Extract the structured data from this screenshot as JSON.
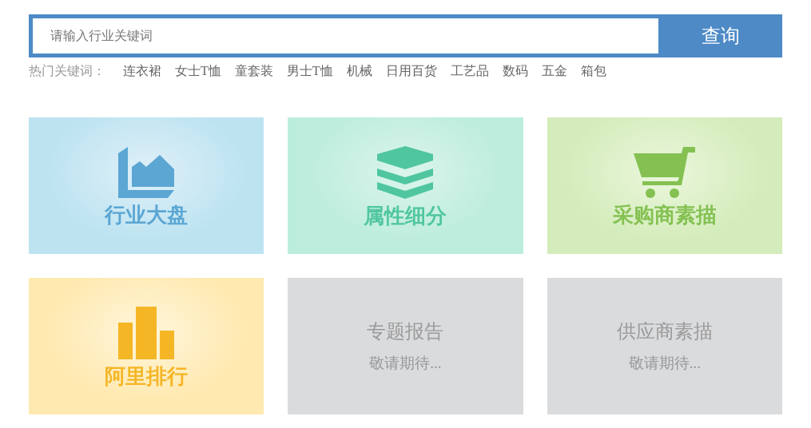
{
  "search": {
    "placeholder": "请输入行业关键词",
    "button": "查询"
  },
  "hot_keywords": {
    "label": "热门关键词：",
    "items": [
      "连衣裙",
      "女士T恤",
      "童套装",
      "男士T恤",
      "机械",
      "日用百货",
      "工艺品",
      "数码",
      "五金",
      "箱包"
    ]
  },
  "cards": [
    {
      "kind": "active",
      "title": "行业大盘",
      "color": "#5ba6d3"
    },
    {
      "kind": "active",
      "title": "属性细分",
      "color": "#50c6a0"
    },
    {
      "kind": "active",
      "title": "采购商素描",
      "color": "#84c152"
    },
    {
      "kind": "active",
      "title": "阿里排行",
      "color": "#f5b626"
    },
    {
      "kind": "coming_soon",
      "title": "专题报告",
      "subtitle": "敬请期待..."
    },
    {
      "kind": "coming_soon",
      "title": "供应商素描",
      "subtitle": "敬请期待..."
    }
  ]
}
